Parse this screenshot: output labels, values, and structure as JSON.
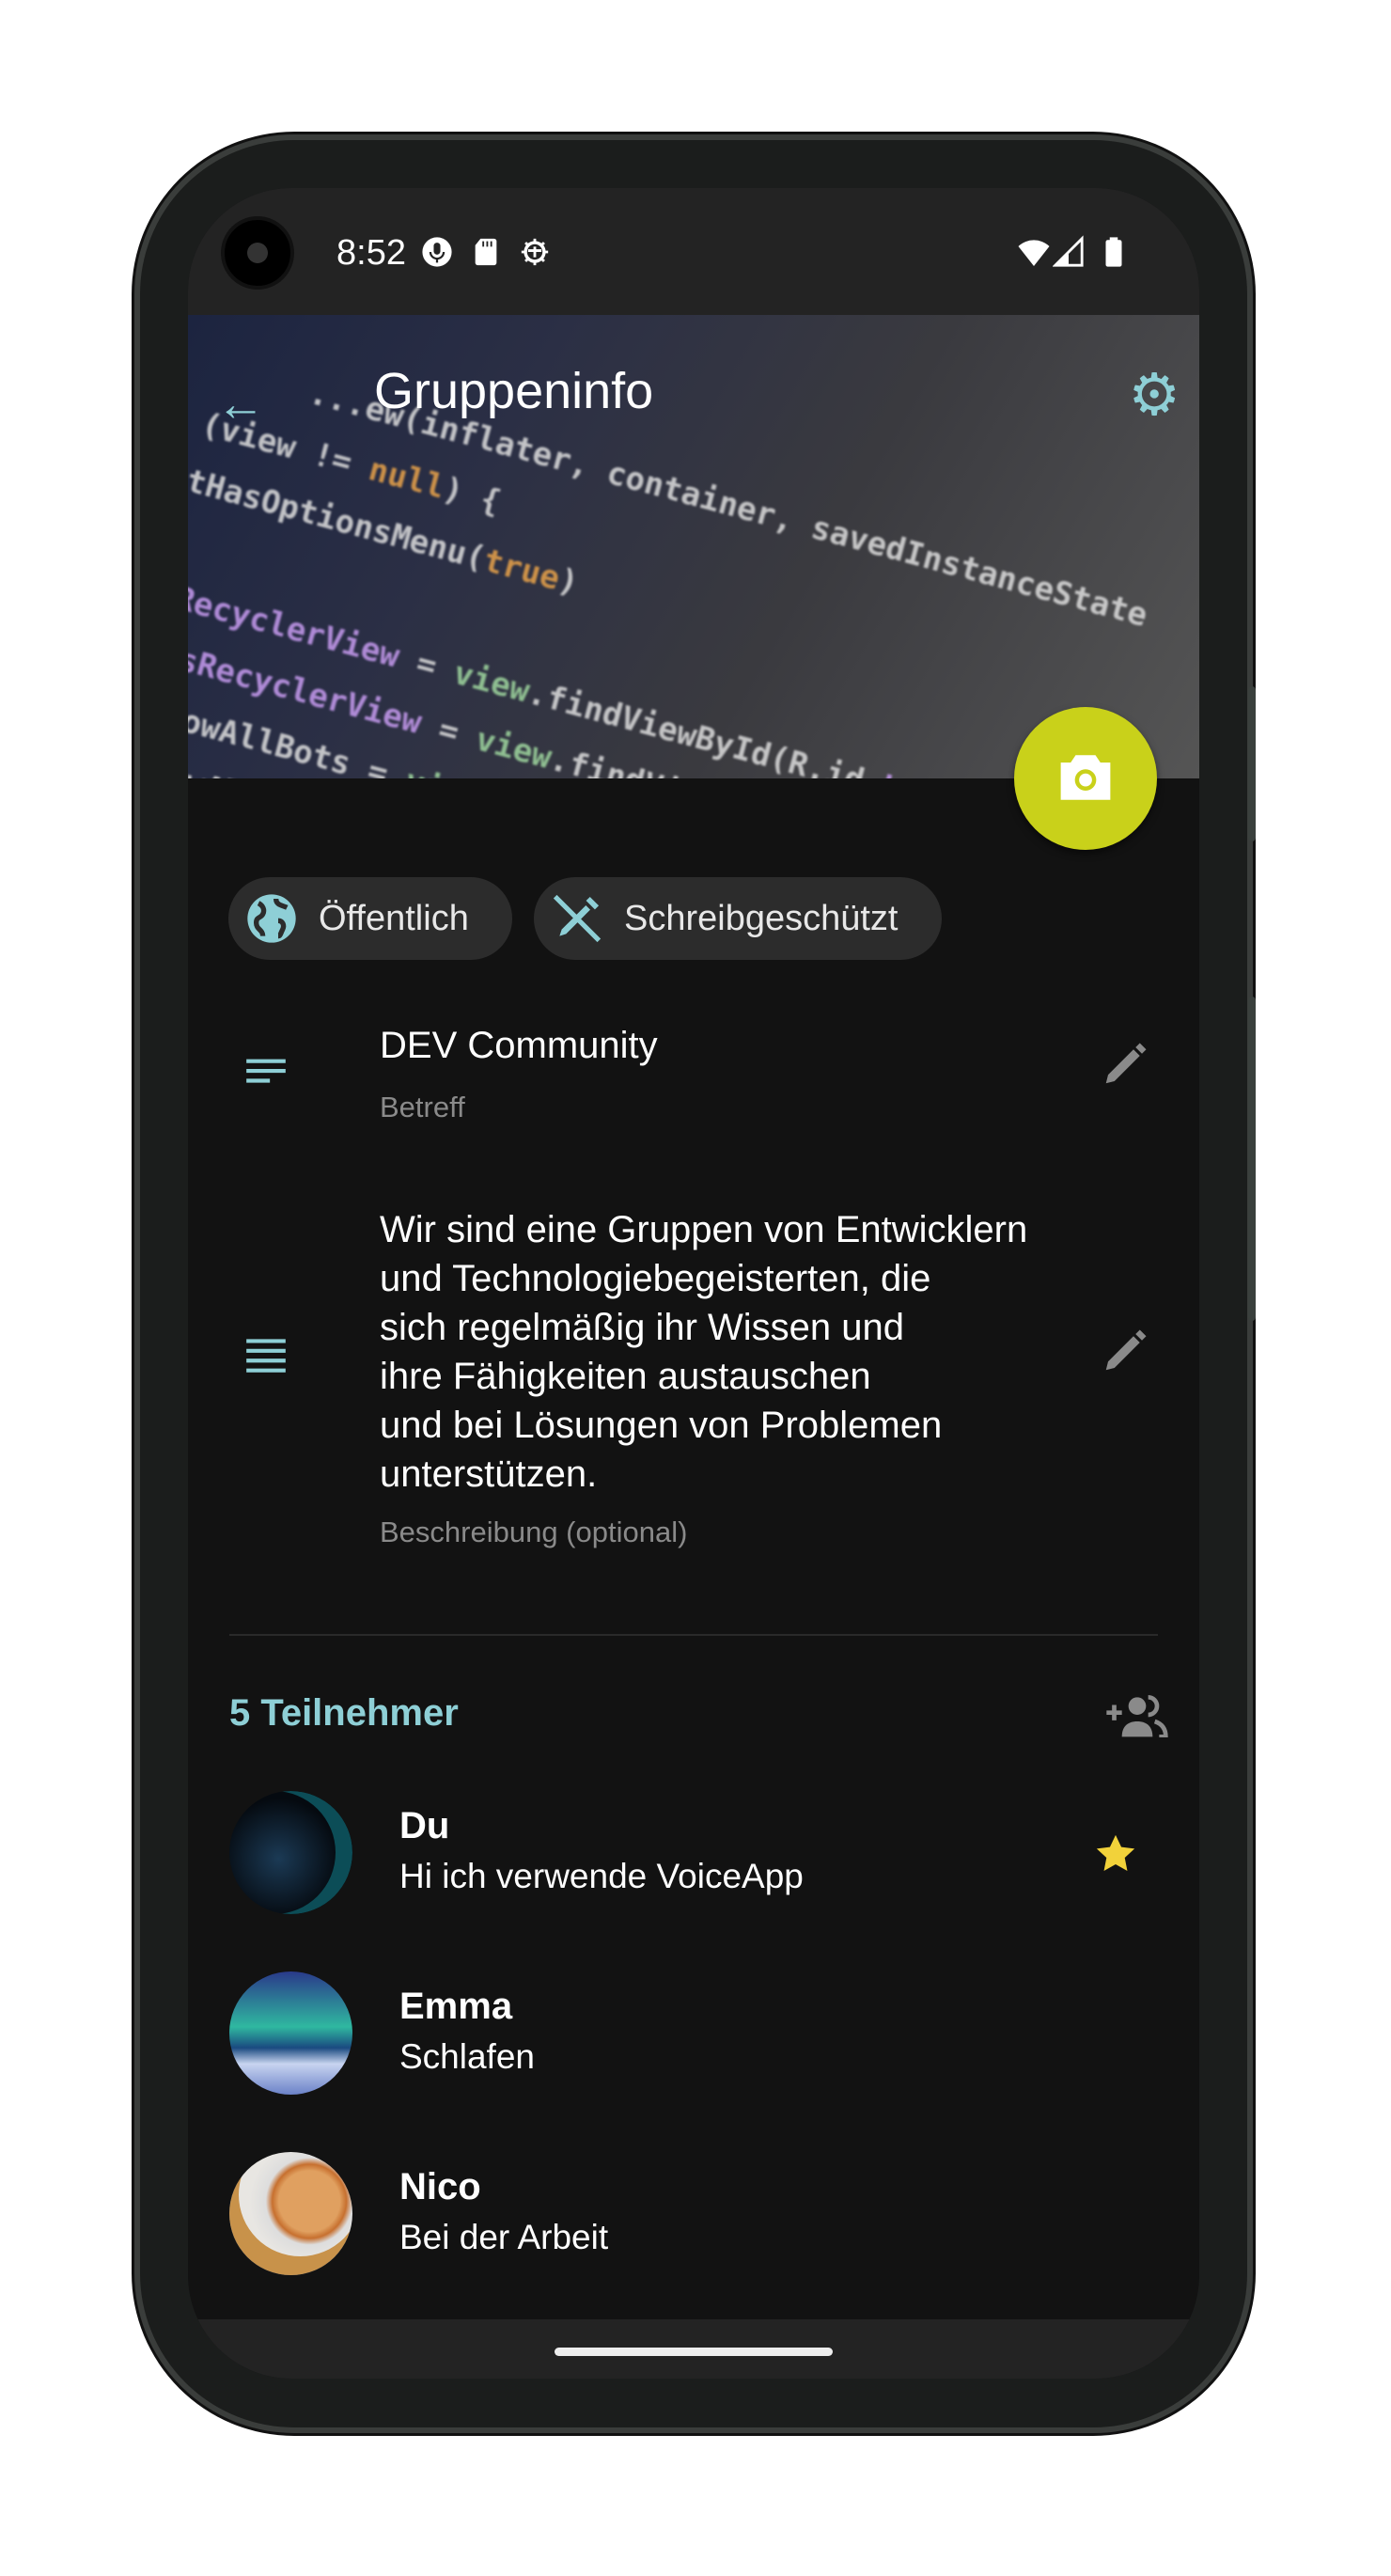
{
  "status_bar": {
    "time": "8:52",
    "icons": [
      "microphone-icon",
      "sd-card-icon",
      "debug-icon",
      "wifi-icon",
      "signal-icon",
      "battery-icon"
    ]
  },
  "header": {
    "title": "Gruppeninfo",
    "back_icon": "arrow-left-icon",
    "settings_icon": "gear-icon",
    "fab_icon": "camera-icon"
  },
  "chips": [
    {
      "label": "Öffentlich",
      "icon": "globe-icon"
    },
    {
      "label": "Schreibgeschützt",
      "icon": "edit-off-icon"
    }
  ],
  "subject": {
    "value": "DEV Community",
    "hint": "Betreff"
  },
  "description": {
    "lines": [
      "Wir sind eine Gruppen von Entwicklern",
      "und Technologiebegeisterten, die",
      "sich regelmäßig ihr Wissen und",
      "ihre Fähigkeiten austauschen",
      "und bei Lösungen von Problemen",
      "unterstützen."
    ],
    "hint": "Beschreibung (optional)"
  },
  "participants": {
    "title": "5 Teilnehmer",
    "members": [
      {
        "name": "Du",
        "status": "Hi ich verwende VoiceApp",
        "admin": true
      },
      {
        "name": "Emma",
        "status": "Schlafen"
      },
      {
        "name": "Nico",
        "status": "Bei der Arbeit"
      }
    ]
  },
  "colors": {
    "accent": "#8ecfd6",
    "fab": "#c9d11a",
    "star": "#f2d23a",
    "background": "#121212"
  }
}
